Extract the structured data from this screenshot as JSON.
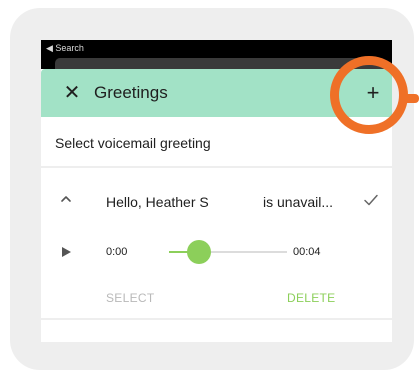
{
  "status_bar": {
    "back_label": "◀ Search"
  },
  "header": {
    "close_glyph": "✕",
    "title": "Greetings",
    "add_glyph": "+"
  },
  "main": {
    "subtitle": "Select voicemail greeting",
    "greeting": {
      "name": "Hello, Heather S",
      "status": "is unavail...",
      "selected": true
    },
    "player": {
      "current_time": "0:00",
      "total_time": "00:04",
      "progress_fraction": 0.25
    },
    "actions": {
      "select_label": "SELECT",
      "delete_label": "DELETE"
    }
  },
  "colors": {
    "header_bg": "#a2e2c6",
    "accent_green": "#8ccf5a",
    "highlight_orange": "#ef7027"
  }
}
